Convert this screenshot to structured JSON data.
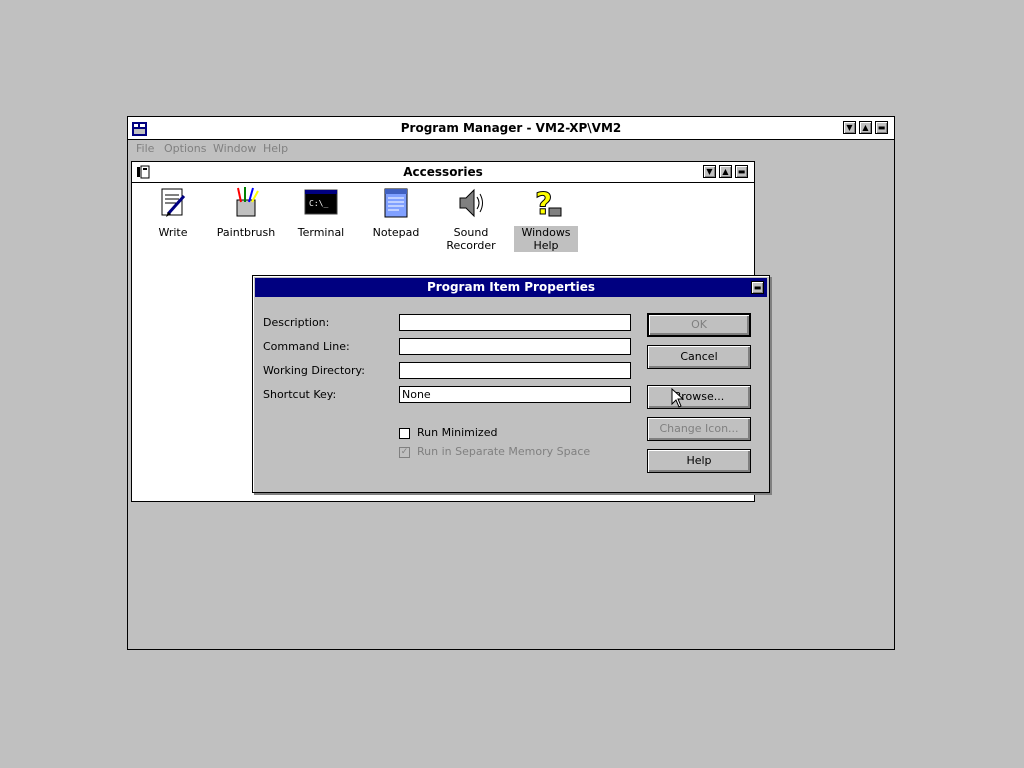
{
  "program_manager": {
    "title": "Program Manager - VM2-XP\\VM2",
    "menu": [
      "File",
      "Options",
      "Window",
      "Help"
    ]
  },
  "accessories": {
    "title": "Accessories",
    "icons": [
      {
        "label_line1": "Write",
        "label_line2": "",
        "icon": "write-icon"
      },
      {
        "label_line1": "Paintbrush",
        "label_line2": "",
        "icon": "paintbrush-icon"
      },
      {
        "label_line1": "Terminal",
        "label_line2": "",
        "icon": "terminal-icon"
      },
      {
        "label_line1": "Notepad",
        "label_line2": "",
        "icon": "notepad-icon"
      },
      {
        "label_line1": "Sound",
        "label_line2": "Recorder",
        "icon": "sound-recorder-icon"
      },
      {
        "label_line1": "Windows",
        "label_line2": "Help",
        "icon": "windows-help-icon",
        "selected": true
      }
    ]
  },
  "dialog": {
    "title": "Program Item Properties",
    "labels": {
      "description": "Description:",
      "command_line": "Command Line:",
      "working_directory": "Working Directory:",
      "shortcut_key": "Shortcut Key:"
    },
    "values": {
      "description": "",
      "command_line": "",
      "working_directory": "",
      "shortcut_key": "None"
    },
    "checkboxes": {
      "run_minimized": {
        "label": "Run Minimized",
        "checked": false
      },
      "run_separate": {
        "label": "Run in Separate Memory Space",
        "checked": true,
        "enabled": false
      }
    },
    "buttons": {
      "ok": "OK",
      "cancel": "Cancel",
      "browse": "Browse...",
      "change_icon": "Change Icon...",
      "help": "Help"
    }
  },
  "colors": {
    "desktop": "#c0c0c0",
    "active_title": "#000080",
    "disabled_text": "#808080"
  }
}
